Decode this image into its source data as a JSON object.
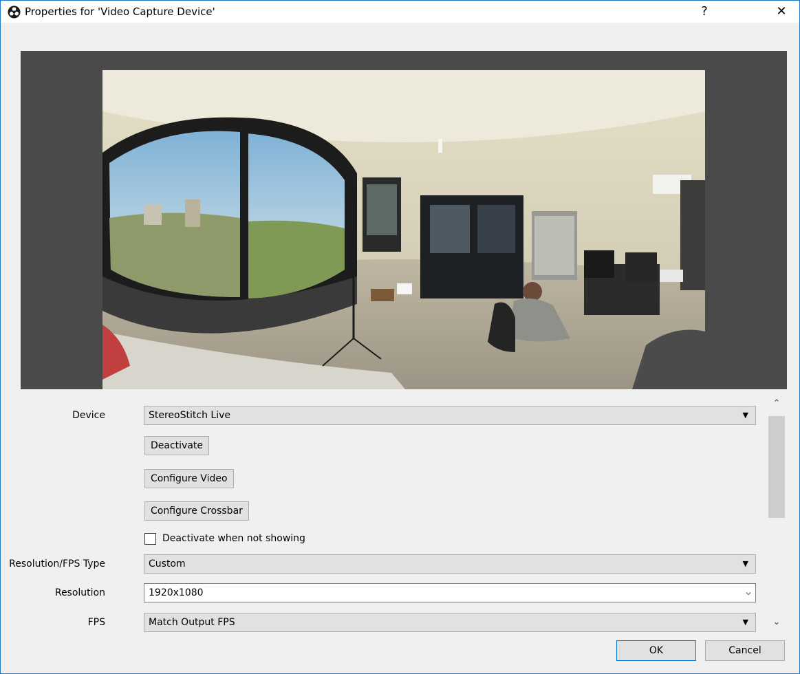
{
  "window": {
    "title": "Properties for 'Video Capture Device'",
    "help_glyph": "?",
    "close_glyph": "✕"
  },
  "preview": {
    "description_icon": "camera-preview-image"
  },
  "properties": {
    "device": {
      "label": "Device",
      "value": "StereoStitch Live"
    },
    "deactivate_button": "Deactivate",
    "configure_video_button": "Configure Video",
    "configure_crossbar_button": "Configure Crossbar",
    "deactivate_when_not_showing": {
      "label": "Deactivate when not showing",
      "checked": false
    },
    "resolution_fps_type": {
      "label": "Resolution/FPS Type",
      "value": "Custom"
    },
    "resolution": {
      "label": "Resolution",
      "value": "1920x1080"
    },
    "fps": {
      "label": "FPS",
      "value": "Match Output FPS"
    }
  },
  "scrollbar": {
    "up_glyph": "⌃",
    "down_glyph": "⌄"
  },
  "buttons": {
    "ok": "OK",
    "cancel": "Cancel"
  },
  "colors": {
    "title_bg": "#ffffff",
    "dialog_bg": "#f0f0f0",
    "accent": "#0078d7",
    "preview_bg": "#4a4a4a"
  }
}
